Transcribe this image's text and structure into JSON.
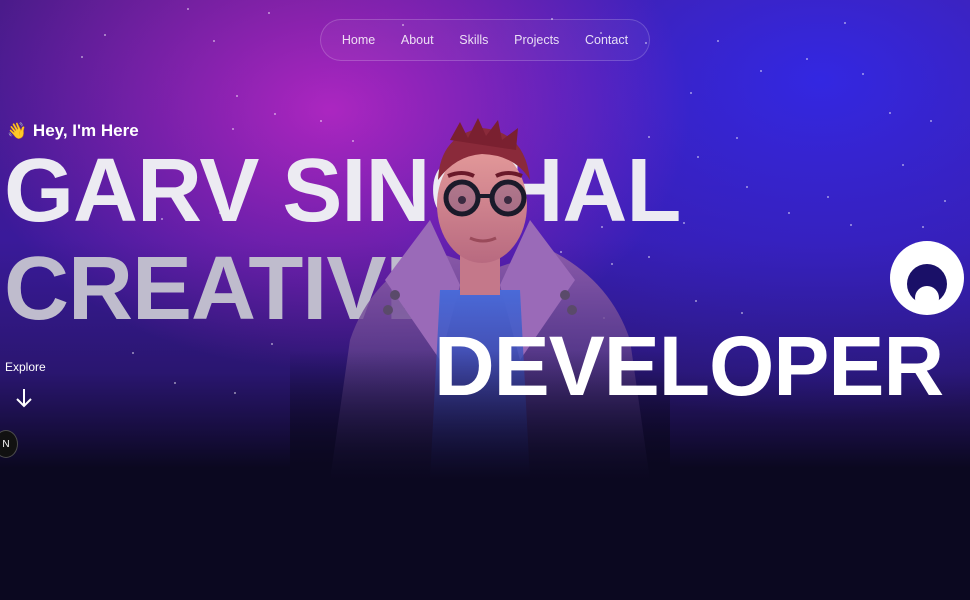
{
  "nav": {
    "items": [
      {
        "label": "Home"
      },
      {
        "label": "About"
      },
      {
        "label": "Skills"
      },
      {
        "label": "Projects"
      },
      {
        "label": "Contact"
      }
    ]
  },
  "hero": {
    "greeting_emoji": "👋",
    "greeting": "Hey, I'm Here",
    "name_line": "GARV SINGHAL",
    "role_line1": "CREATIVE",
    "role_line2": "DEVELOPER",
    "explore_label": "Explore",
    "side_badge": "N"
  },
  "icons": {
    "explore_arrow": "arrow-down-icon",
    "logo": "logo-mark-icon",
    "wave": "waving-hand-icon"
  },
  "colors": {
    "background_dark": "#0b0820",
    "gradient_magenta": "#be28c8",
    "gradient_blue": "#3228e6",
    "text_primary": "#ffffff"
  }
}
